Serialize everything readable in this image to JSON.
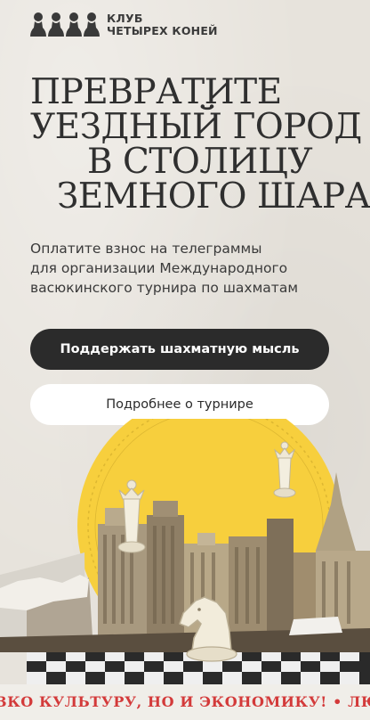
{
  "brand": {
    "name_line1": "КЛУБ",
    "name_line2": "ЧЕТЫРЕХ КОНЕЙ",
    "logo_icon": "chess-pawns-icon"
  },
  "hero": {
    "headline_line1": "ПРЕВРАТИТЕ",
    "headline_line2": "УЕЗДНЫЙ ГОРОД",
    "headline_line3": "В СТОЛИЦУ",
    "headline_line4": "ЗЕМНОГО ШАРА",
    "subtitle_line1": "Оплатите взнос на телеграммы",
    "subtitle_line2": "для организации Международного",
    "subtitle_line3": "васюкинского турнира по шахматам"
  },
  "buttons": {
    "primary_label": "Поддержать шахматную мысль",
    "secondary_label": "Подробнее о турнире"
  },
  "illustration": {
    "icons": [
      "chess-queen-icon",
      "chess-knight-icon",
      "city-skyline-icon",
      "stamp-seal-icon"
    ]
  },
  "ticker": {
    "text": "ВКО КУЛЬТУРУ, НО И ЭКОНОМИКУ! • ЛЮ"
  },
  "colors": {
    "background": "#e7e3dc",
    "text_dark": "#2f2f2f",
    "button_dark": "#2b2b2b",
    "sun_yellow": "#f7cf3d",
    "ticker_red": "#d33a3a"
  }
}
